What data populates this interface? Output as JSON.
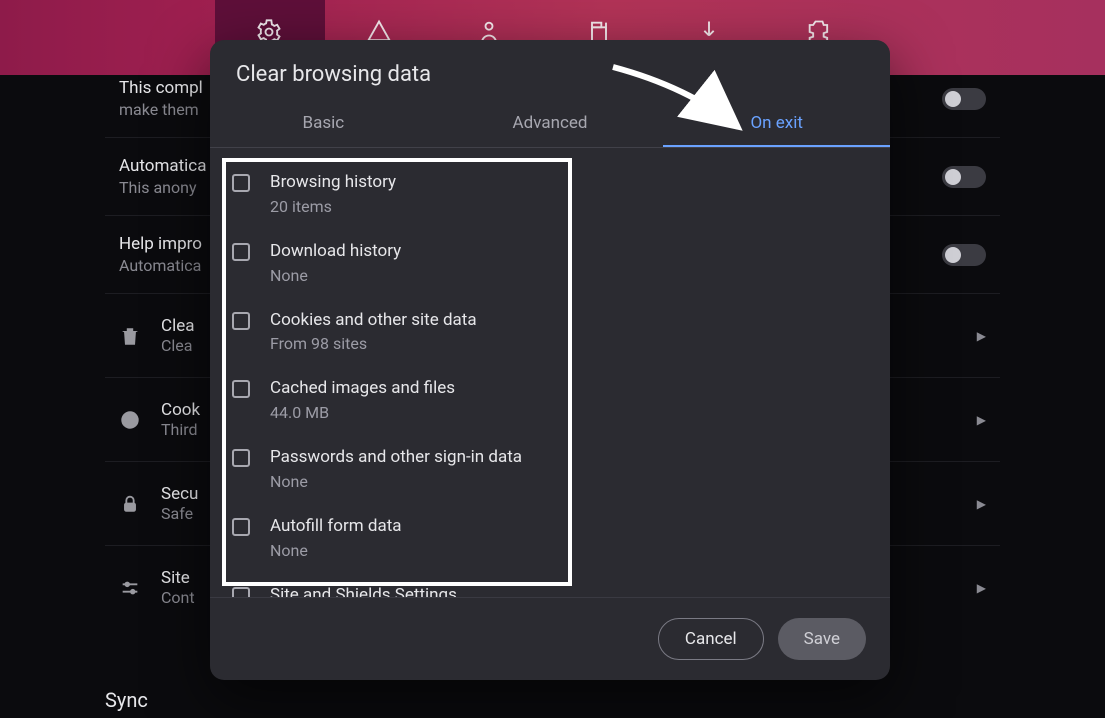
{
  "topbar_icons": [
    "settings-gear-icon",
    "shield-triangle-icon",
    "rewards-icon",
    "wallet-icon",
    "download-icon",
    "extension-icon"
  ],
  "settings_rows": [
    {
      "title": "This compl",
      "subtitle": "make them",
      "has_toggle": true,
      "toggle_on": true
    },
    {
      "title": "Automatica",
      "subtitle": "This anony",
      "has_toggle": true,
      "toggle_on": false
    },
    {
      "title": "Help impro",
      "subtitle": "Automatica",
      "has_toggle": true,
      "toggle_on": false
    }
  ],
  "nav_rows": [
    {
      "icon": "trash-icon",
      "title": "Clea",
      "subtitle": "Clea"
    },
    {
      "icon": "cookie-icon",
      "title": "Cook",
      "subtitle": "Third"
    },
    {
      "icon": "lock-icon",
      "title": "Secu",
      "subtitle": "Safe"
    },
    {
      "icon": "sliders-icon",
      "title": "Site",
      "subtitle": "Cont"
    }
  ],
  "sync_heading": "Sync",
  "dialog": {
    "title": "Clear browsing data",
    "tabs": {
      "basic": "Basic",
      "advanced": "Advanced",
      "on_exit": "On exit"
    },
    "active_tab": "on_exit",
    "options": [
      {
        "label": "Browsing history",
        "sub": "20 items"
      },
      {
        "label": "Download history",
        "sub": "None"
      },
      {
        "label": "Cookies and other site data",
        "sub": "From 98 sites"
      },
      {
        "label": "Cached images and files",
        "sub": "44.0 MB"
      },
      {
        "label": "Passwords and other sign-in data",
        "sub": "None"
      },
      {
        "label": "Autofill form data",
        "sub": "None"
      },
      {
        "label": "Site and Shields Settings",
        "sub": ""
      }
    ],
    "buttons": {
      "cancel": "Cancel",
      "save": "Save"
    }
  }
}
